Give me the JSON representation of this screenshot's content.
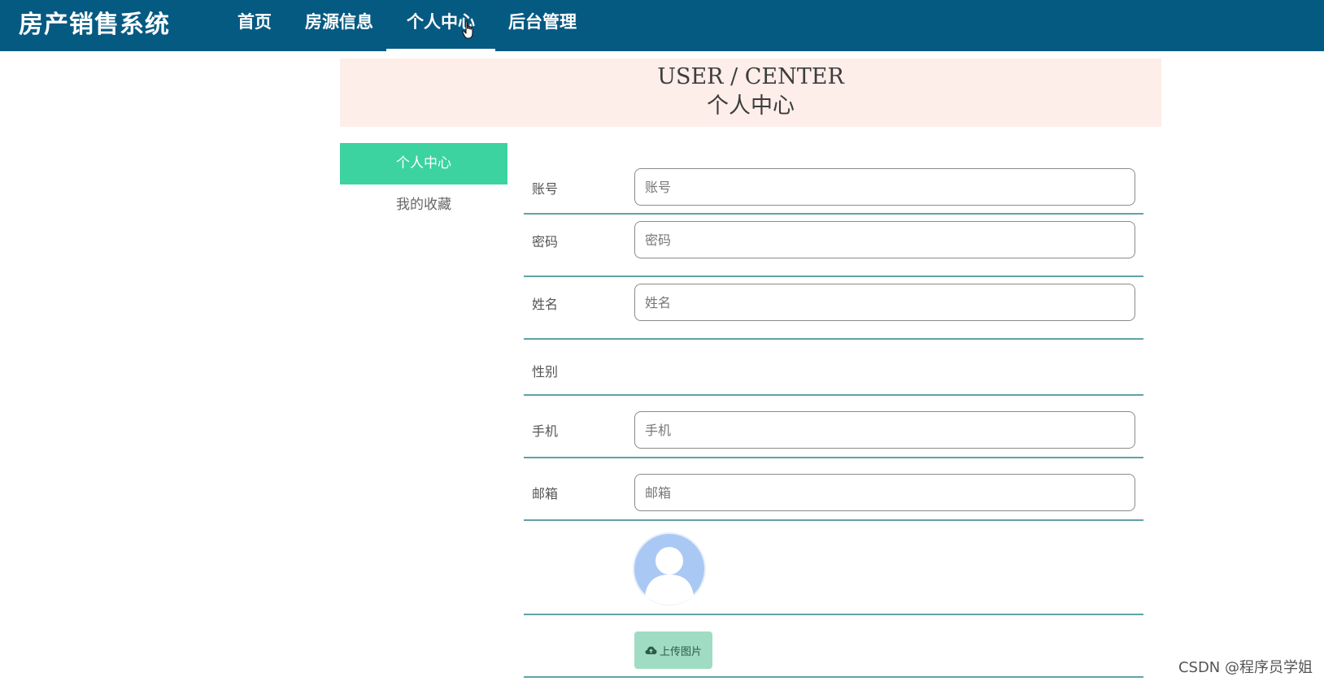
{
  "app": {
    "brand": "房产销售系统"
  },
  "nav": {
    "items": [
      {
        "label": "首页"
      },
      {
        "label": "房源信息"
      },
      {
        "label": "个人中心"
      },
      {
        "label": "后台管理"
      }
    ],
    "active": "个人中心"
  },
  "banner": {
    "title_en": "USER / CENTER",
    "title_cn": "个人中心"
  },
  "side_menu": {
    "items": [
      {
        "label": "个人中心"
      },
      {
        "label": "我的收藏"
      }
    ],
    "active": "个人中心"
  },
  "form": {
    "account": {
      "label": "账号",
      "placeholder": "账号",
      "value": ""
    },
    "password": {
      "label": "密码",
      "placeholder": "密码",
      "value": ""
    },
    "name": {
      "label": "姓名",
      "placeholder": "姓名",
      "value": ""
    },
    "gender": {
      "label": "性别"
    },
    "phone": {
      "label": "手机",
      "placeholder": "手机",
      "value": ""
    },
    "email": {
      "label": "邮箱",
      "placeholder": "邮箱",
      "value": ""
    },
    "upload_label": "上传图片"
  },
  "icons": {
    "avatar": "default-avatar-icon",
    "upload": "cloud-upload-icon",
    "cursor": "hand-pointer-icon"
  },
  "colors": {
    "nav_bg": "#055a82",
    "accent": "#3cd3a1",
    "banner_bg": "#fdeee9",
    "row_divider": "#5fa3a6",
    "upload_bg": "#9fdcc3",
    "avatar": "#a9c9f4"
  },
  "watermark": "CSDN @程序员学姐"
}
